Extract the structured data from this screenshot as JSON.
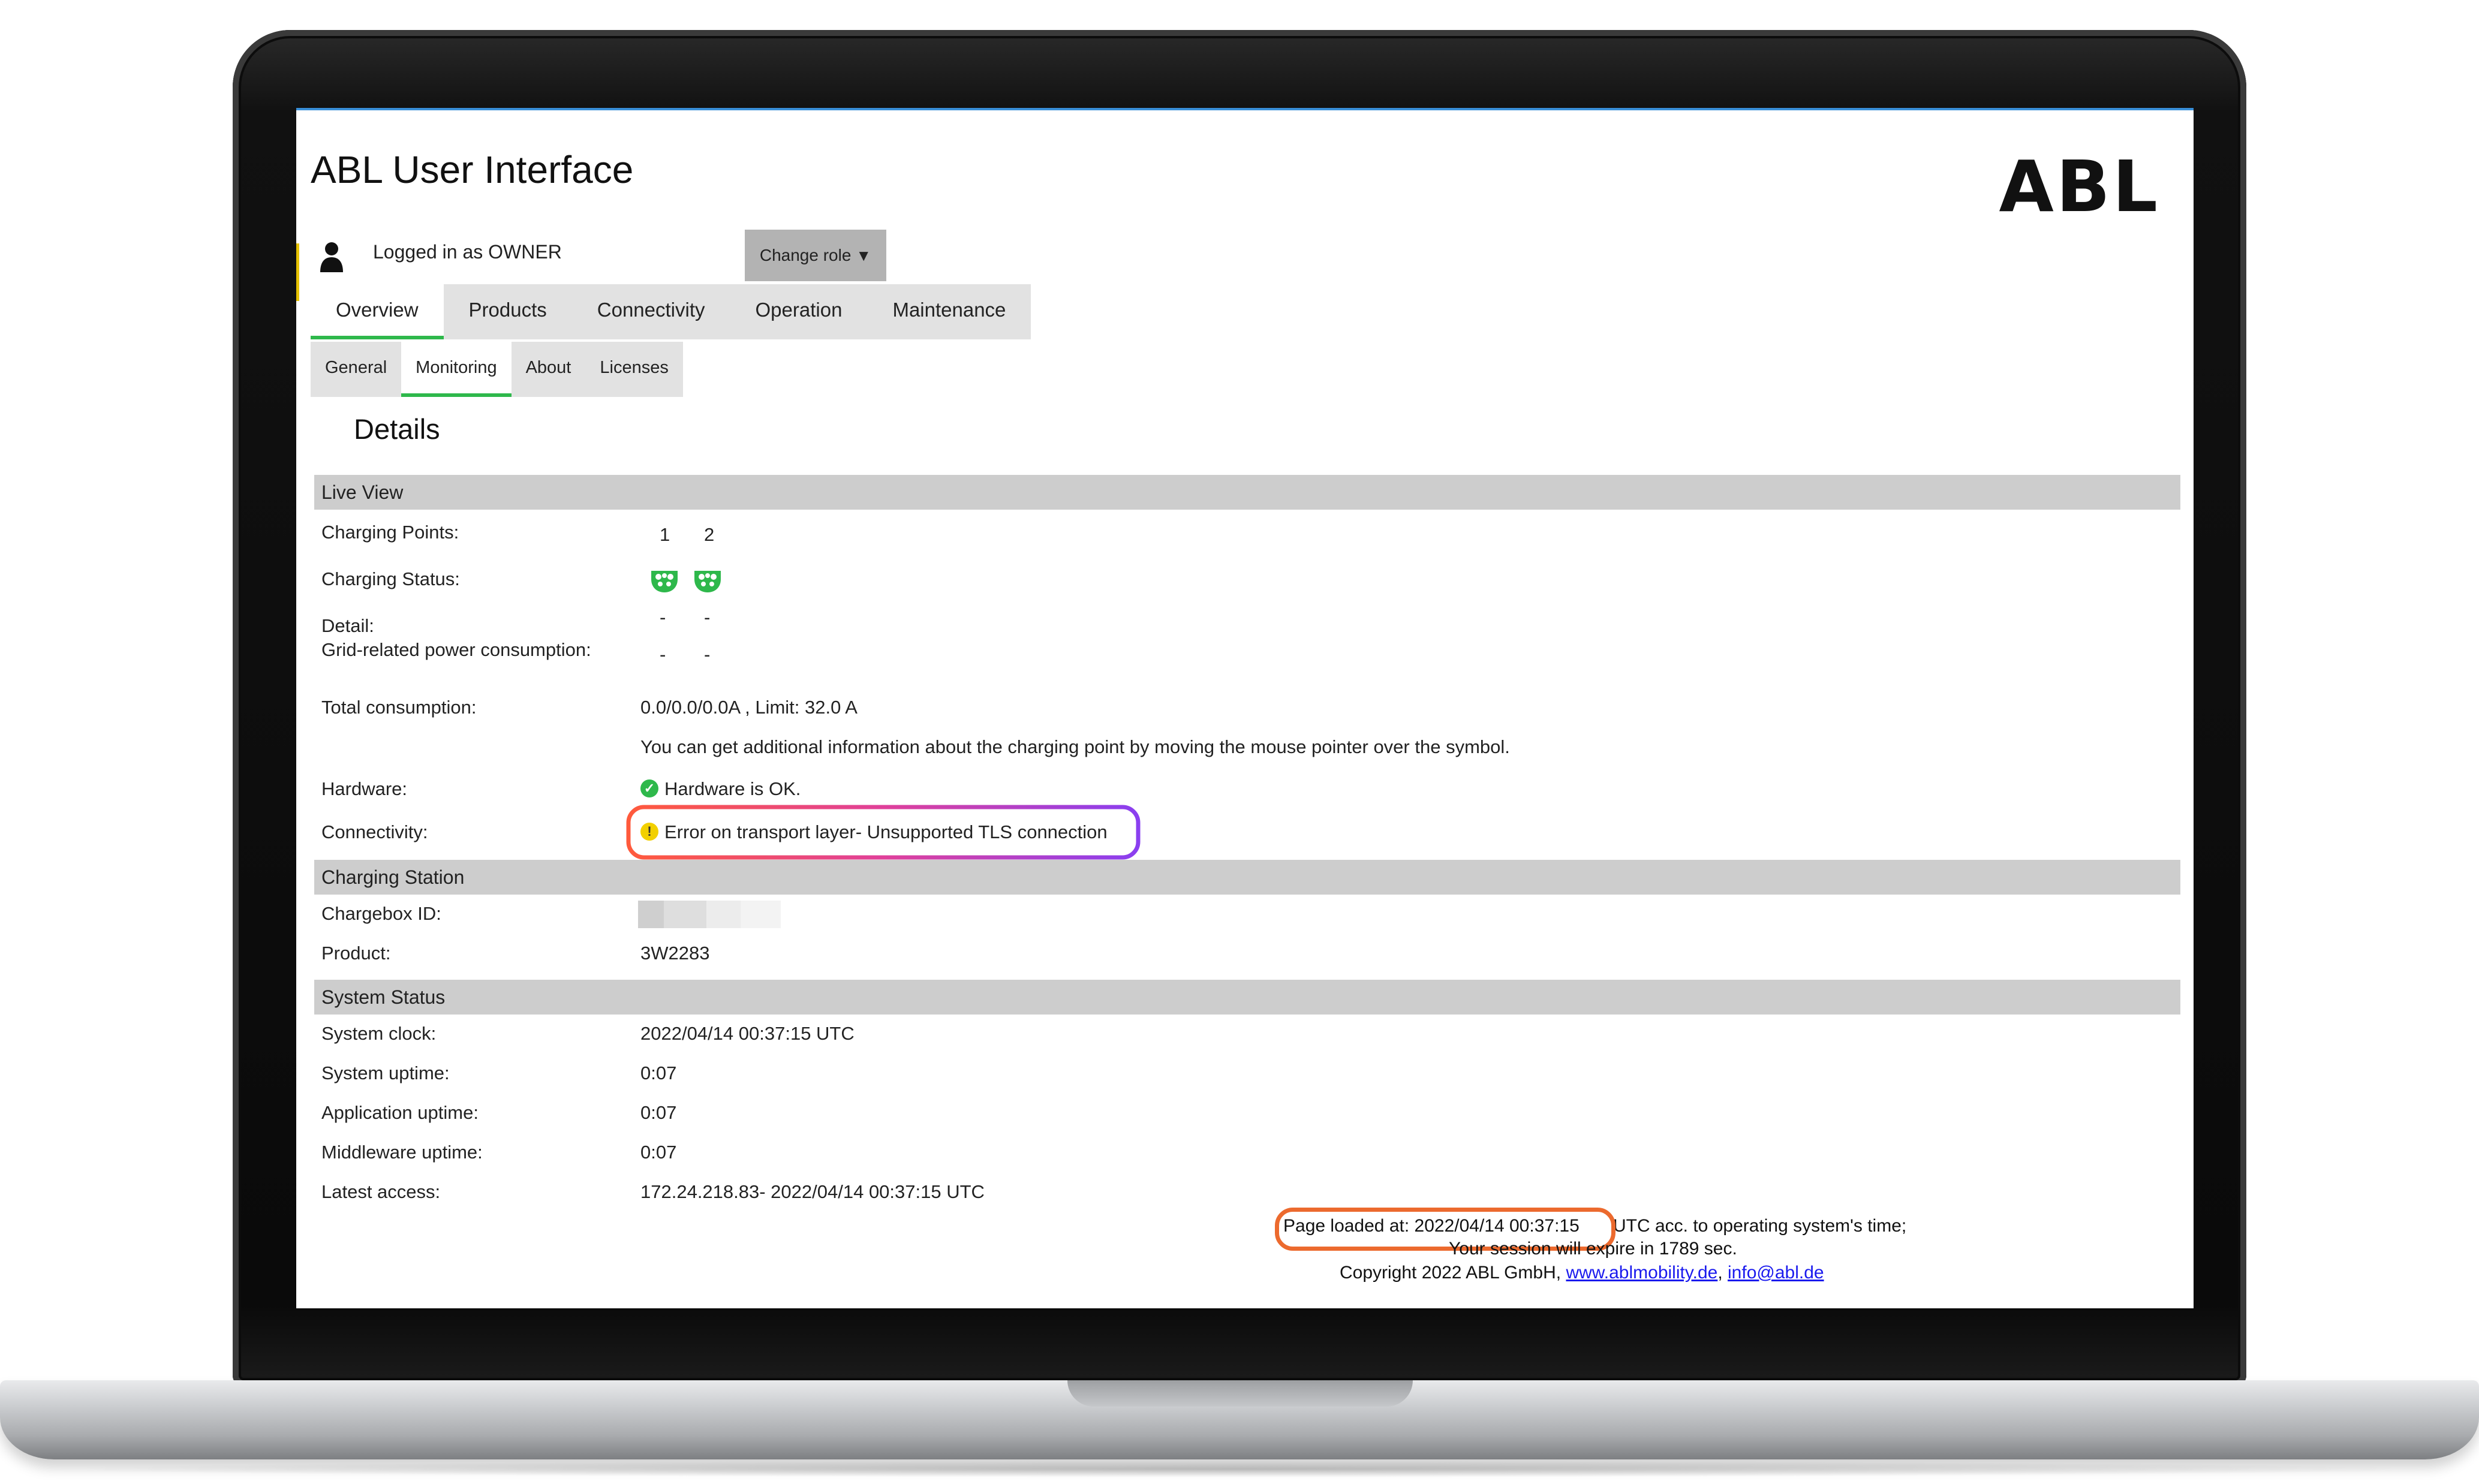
{
  "app": {
    "title": "ABL User Interface",
    "logo_text": "ABL"
  },
  "user": {
    "logged_in_text": "Logged in as OWNER",
    "change_role_label": "Change role",
    "change_role_arrow": "▼"
  },
  "main_tabs": [
    {
      "label": "Overview",
      "active": true
    },
    {
      "label": "Products",
      "active": false
    },
    {
      "label": "Connectivity",
      "active": false
    },
    {
      "label": "Operation",
      "active": false
    },
    {
      "label": "Maintenance",
      "active": false
    }
  ],
  "sub_tabs": [
    {
      "label": "General",
      "active": false
    },
    {
      "label": "Monitoring",
      "active": true
    },
    {
      "label": "About",
      "active": false
    },
    {
      "label": "Licenses",
      "active": false
    }
  ],
  "details_title": "Details",
  "live_view": {
    "header": "Live View",
    "charging_points_label": "Charging Points:",
    "charging_points": [
      "1",
      "2"
    ],
    "charging_status_label": "Charging Status:",
    "charging_status_icon": "ev-plug-icon",
    "charging_status_color": "#2eb84b",
    "detail_label": "Detail:",
    "detail_values": [
      "-",
      "-"
    ],
    "grid_label": "Grid-related power consumption:",
    "grid_values": [
      "-",
      "-"
    ],
    "total_label": "Total consumption:",
    "total_value": "0.0/0.0/0.0A , Limit: 32.0 A",
    "info_text": "You can get additional information about the charging point by moving the mouse pointer over the symbol.",
    "hardware_label": "Hardware:",
    "hardware_value": "Hardware is OK.",
    "hardware_icon": "check-circle-icon",
    "connectivity_label": "Connectivity:",
    "connectivity_value": "Error on transport layer- Unsupported TLS connection",
    "connectivity_icon": "warning-circle-icon"
  },
  "charging_station": {
    "header": "Charging Station",
    "chargebox_label": "Chargebox ID:",
    "product_label": "Product:",
    "product_value": "3W2283"
  },
  "system_status": {
    "header": "System Status",
    "rows": [
      {
        "label": "System clock:",
        "value": "2022/04/14 00:37:15 UTC"
      },
      {
        "label": "System uptime:",
        "value": "0:07"
      },
      {
        "label": "Application uptime:",
        "value": "0:07"
      },
      {
        "label": "Middleware uptime:",
        "value": "0:07"
      },
      {
        "label": "Latest access:",
        "value": "172.24.218.83- 2022/04/14 00:37:15 UTC"
      }
    ]
  },
  "footer": {
    "page_loaded": "Page loaded at: 2022/04/14 00:37:15",
    "page_loaded_suffix": "UTC acc. to operating system's time;",
    "session": "Your session will expire in 1789 sec.",
    "copyright": "Copyright 2022 ABL GmbH,",
    "link_website": "www.ablmobility.de",
    "link_email": "info@abl.de",
    "separator": ","
  },
  "colors": {
    "accent_green": "#2eb84b",
    "warning_yellow": "#f2d000",
    "highlight_orange": "#ec6a2e",
    "highlight_purple": "#8a3ff0",
    "link_blue": "#1a1aee"
  }
}
